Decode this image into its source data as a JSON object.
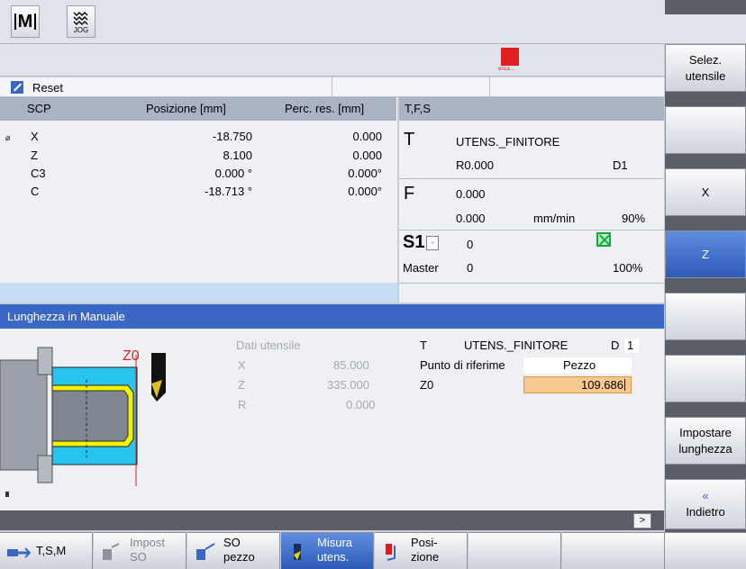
{
  "top": {
    "mode": "JOG"
  },
  "status": {
    "alarm_text": "enca..."
  },
  "channel": {
    "state": "Reset"
  },
  "positions": {
    "headers": {
      "axis": "SCP",
      "position": "Posizione [mm]",
      "dtg": "Perc. res. [mm]"
    },
    "diameter_mark": "⌀",
    "rows": [
      {
        "axis": "X",
        "pos": "-18.750",
        "dtg": "0.000"
      },
      {
        "axis": "Z",
        "pos": "8.100",
        "dtg": "0.000"
      },
      {
        "axis": "C3",
        "pos": "0.000 °",
        "dtg": "0.000°"
      },
      {
        "axis": "C",
        "pos": "-18.713 °",
        "dtg": "0.000°"
      }
    ]
  },
  "tfs": {
    "title": "T,F,S",
    "t_letter": "T",
    "tool_name": "UTENS._FINITORE",
    "radius": "R0.000",
    "edge": "D1",
    "f_letter": "F",
    "feed": "0.000",
    "feed_set": "0.000",
    "feed_unit": "mm/min",
    "feed_override": "90%",
    "s_letter": "S1",
    "spindle_dd": "·",
    "speed": "0",
    "master_label": "Master",
    "master_value": "0",
    "speed_override": "100%"
  },
  "dialog": {
    "title": "Lunghezza in Manuale",
    "z0_mark": "Z0",
    "tool_data": {
      "title": "Dati utensile",
      "rows": [
        {
          "label": "X",
          "value": "85.000"
        },
        {
          "label": "Z",
          "value": "335.000"
        },
        {
          "label": "R",
          "value": "0.000"
        }
      ]
    },
    "t_label": "T",
    "t_value": "UTENS._FINITORE",
    "d_label": "D",
    "d_value": "1",
    "ref_label": "Punto di riferime",
    "ref_value": "Pezzo",
    "z0_label": "Z0",
    "z0_value": "109.686"
  },
  "infoline": {
    "more_label": ">"
  },
  "vertical_softkeys": [
    {
      "line1": "Selez.",
      "line2": "utensile"
    },
    {
      "line1": "",
      "line2": ""
    },
    {
      "line1": "X",
      "line2": ""
    },
    {
      "line1": "Z",
      "line2": "",
      "active": true
    },
    {
      "line1": "",
      "line2": ""
    },
    {
      "line1": "",
      "line2": ""
    },
    {
      "line1": "Impostare",
      "line2": "lunghezza"
    },
    {
      "line1": "«",
      "line2": "Indietro"
    }
  ],
  "horizontal_softkeys": [
    {
      "line1": "T,S,M",
      "line2": ""
    },
    {
      "line1": "Impost",
      "line2": "SO"
    },
    {
      "line1": "SO",
      "line2": "pezzo"
    },
    {
      "line1": "Misura",
      "line2": "utens."
    },
    {
      "line1": "Posi-",
      "line2": "zione"
    }
  ],
  "colors": {
    "accent": "#3a66c4",
    "input_highlight": "#f7c98e",
    "spindle": "#12a83c",
    "alarm": "#e02020"
  }
}
